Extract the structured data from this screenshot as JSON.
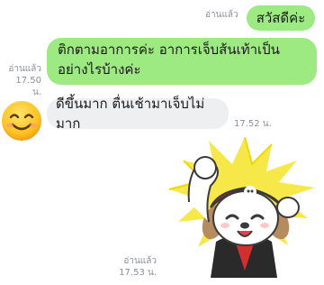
{
  "chat": {
    "messages": [
      {
        "side": "out",
        "text": "สวัสดีค่ะ",
        "read_label": "อ่านแล้ว",
        "time": ""
      },
      {
        "side": "out",
        "text_line1": "ติกตามอาการค่ะ อาการเจ็บส้นเท้าเป็น",
        "text_line2": "อย่างไรบ้างค่ะ",
        "read_label": "อ่านแล้ว",
        "time": "17.50 น."
      },
      {
        "side": "in",
        "text": "ดีขึ้นมาก ตื่นเช้ามาเจ็บไม่มาก",
        "time": "17.52 น."
      },
      {
        "side": "out",
        "type": "sticker",
        "read_label": "อ่านแล้ว",
        "time": "17.53 น."
      }
    ]
  },
  "colors": {
    "outgoing_bubble": "#9cea81",
    "incoming_bubble": "#eeeff1",
    "meta_text": "#8a8f99"
  },
  "icons": {
    "contact_avatar": "smiling-face-emoji",
    "sticker": "pirate-dog-sticker"
  }
}
